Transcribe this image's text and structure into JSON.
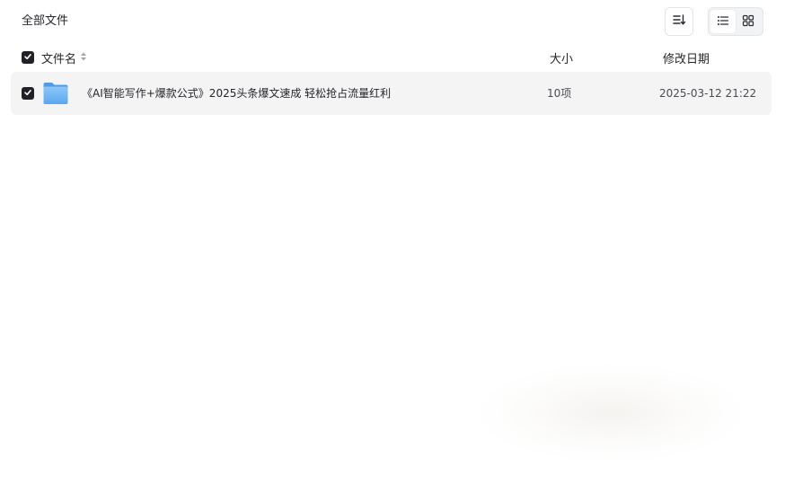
{
  "breadcrumb": {
    "label": "全部文件"
  },
  "header": {
    "name_label": "文件名",
    "size_label": "大小",
    "date_label": "修改日期"
  },
  "rows": [
    {
      "name": "《AI智能写作+爆款公式》2025头条爆文速成 轻松抢占流量红利",
      "size": "10项",
      "modified": "2025-03-12 21:22",
      "selected": true,
      "icon": "folder-icon"
    }
  ],
  "toolbar": {
    "sort_icon": "sort-icon",
    "list_view_icon": "list-view-icon",
    "grid_view_icon": "grid-view-icon",
    "active_view": "list"
  },
  "colors": {
    "folder": "#6fb3f2",
    "checkbox": "#1f2126",
    "row_bg": "#f4f4f5"
  }
}
